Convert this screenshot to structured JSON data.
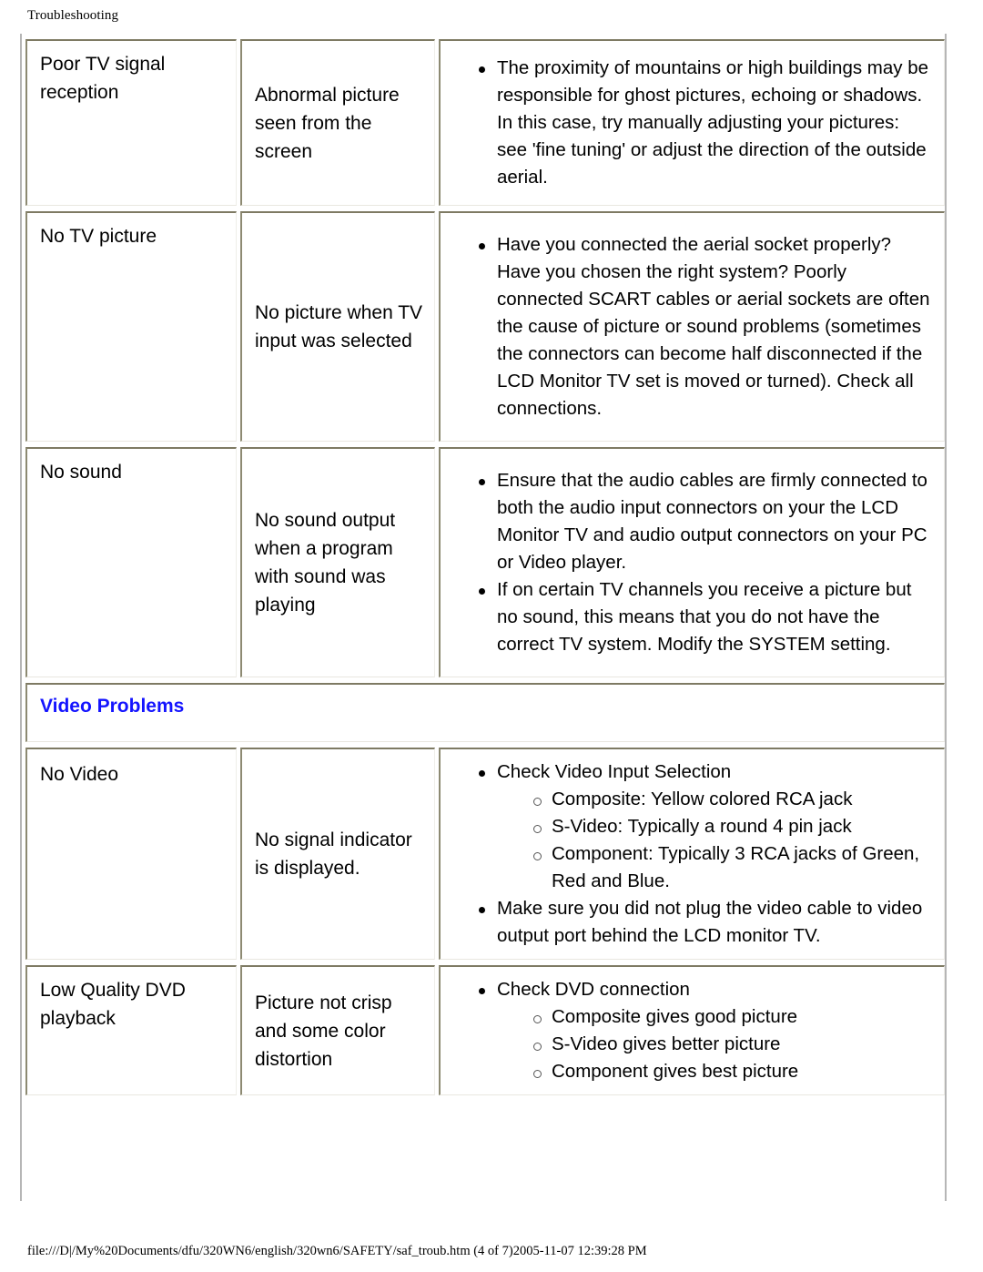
{
  "header": {
    "title": "Troubleshooting"
  },
  "colors": {
    "section_heading": "#1414ff",
    "cell_border": "#7e7a63",
    "table_edge": "#b6b6b6"
  },
  "table": {
    "rows": [
      {
        "symptom": "Poor TV signal reception",
        "detail": "Abnormal picture seen from the screen",
        "solutions": [
          {
            "text": "The proximity of mountains or high buildings may be responsible for ghost pictures, echoing or shadows. In this case, try manually adjusting your pictures: see 'fine tuning' or adjust the direction of the outside aerial.",
            "sub": []
          }
        ]
      },
      {
        "symptom": "No TV picture",
        "detail": "No picture when TV input was selected",
        "solutions": [
          {
            "text": "Have you connected the aerial socket properly? Have you chosen the right system? Poorly connected SCART cables or aerial sockets are often the cause of picture or sound problems (sometimes the connectors can become half disconnected if the LCD Monitor TV set is moved or turned). Check all connections.",
            "sub": []
          }
        ]
      },
      {
        "symptom": "No sound",
        "detail": "No sound output when a program with sound was playing",
        "solutions": [
          {
            "text": "Ensure that the audio cables are firmly connected to both the audio input connectors on your the LCD Monitor TV and audio output connectors on your PC or Video player.",
            "sub": []
          },
          {
            "text": "If on certain TV channels you receive a picture but no sound, this means that you do not have the correct TV system. Modify the SYSTEM setting.",
            "sub": []
          }
        ]
      }
    ],
    "section_heading": "Video Problems",
    "rows2": [
      {
        "symptom": "No Video",
        "detail": "No signal indicator is displayed.",
        "solutions": [
          {
            "text": "Check Video Input Selection",
            "sub": [
              "Composite: Yellow colored RCA jack",
              "S-Video: Typically a round 4 pin jack",
              "Component: Typically 3 RCA jacks of Green, Red and Blue."
            ]
          },
          {
            "text": "Make sure you did not plug the video cable to video output port behind the LCD monitor TV.",
            "sub": []
          }
        ]
      },
      {
        "symptom": "Low Quality DVD playback",
        "detail": "Picture not crisp and some color distortion",
        "solutions": [
          {
            "text": "Check DVD connection",
            "sub": [
              "Composite gives good picture",
              "S-Video gives better picture",
              "Component gives best picture"
            ]
          }
        ]
      }
    ]
  },
  "footer": {
    "path": "file:///D|/My%20Documents/dfu/320WN6/english/320wn6/SAFETY/saf_troub.htm (4 of 7)2005-11-07 12:39:28 PM"
  }
}
